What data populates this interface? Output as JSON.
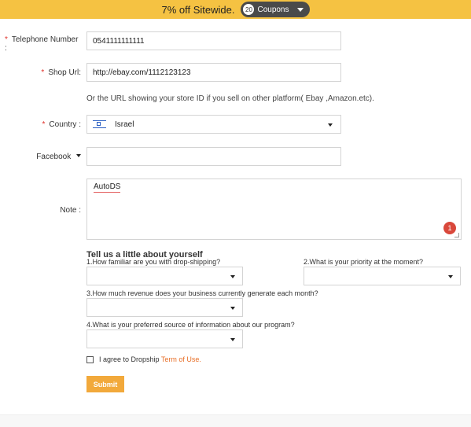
{
  "promo": {
    "text": "7% off Sitewide.",
    "coupon_count": "20",
    "coupon_label": "Coupons"
  },
  "form": {
    "telephone": {
      "label": "Telephone Number :",
      "value": "0541111111111",
      "required": true
    },
    "shop_url": {
      "label": "Shop Url:",
      "value": "http://ebay.com/1112123123",
      "required": true,
      "hint": "Or the URL showing your store ID if you sell on other platform( Ebay ,Amazon.etc)."
    },
    "country": {
      "label": "Country :",
      "value": "Israel",
      "flag_icon": "israel-flag-icon",
      "required": true
    },
    "social": {
      "label": "Facebook",
      "value": ""
    },
    "note": {
      "label": "Note :",
      "value": "AutoDS",
      "badge": "1"
    }
  },
  "survey": {
    "title": "Tell us a little about yourself",
    "q1": "1.How familiar are you with drop-shipping?",
    "q2": "2.What is your priority at the moment?",
    "q3": "3.How much revenue does your business currently generate each month?",
    "q4": "4.What is your preferred source of information about our program?"
  },
  "agreement": {
    "text": "I agree to Dropship",
    "link": "Term of Use."
  },
  "submit_label": "Submit",
  "colors": {
    "promo_bg": "#f5c242",
    "required": "#e0322b",
    "submit_bg": "#f2a93b",
    "terms_link": "#e8702a"
  }
}
